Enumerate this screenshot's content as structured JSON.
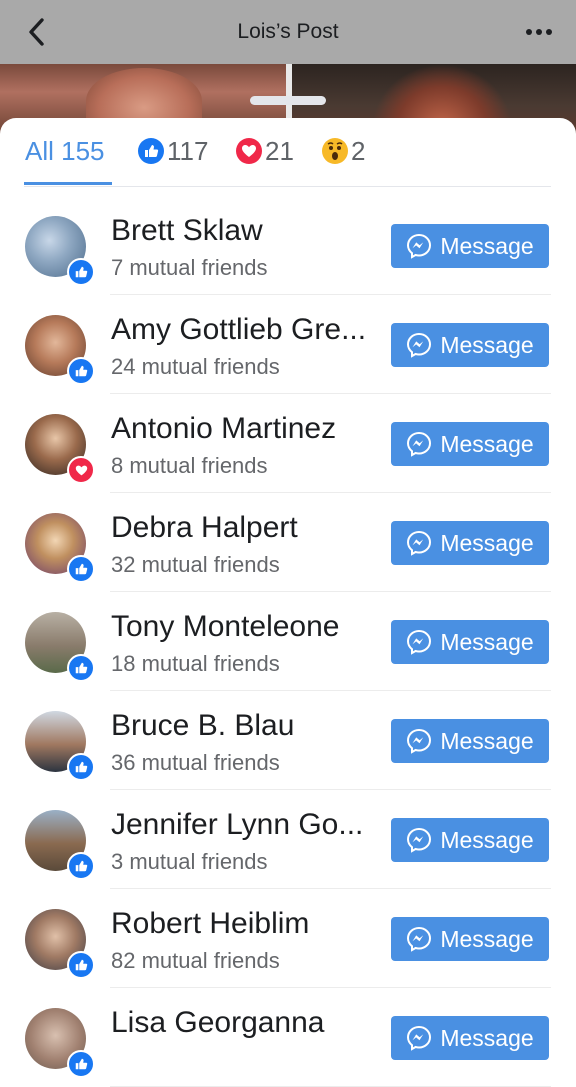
{
  "nav": {
    "title": "Lois’s Post",
    "back_icon": "chevron-left-icon",
    "more_icon": "more-dots-icon"
  },
  "colors": {
    "accent": "#4a90e2",
    "like": "#1877f2",
    "love": "#f02849",
    "wow": "#f7b928",
    "nav_bg": "#a9a9a9"
  },
  "tabs": {
    "all": "All 155",
    "like_count": "117",
    "love_count": "21",
    "wow_count": "2",
    "selected": "All"
  },
  "people": [
    {
      "name": "Brett Sklaw",
      "mutual": "7 mutual friends",
      "reaction": "like",
      "button": "Message"
    },
    {
      "name": "Amy Gottlieb Gre...",
      "mutual": "24 mutual friends",
      "reaction": "like",
      "button": "Message"
    },
    {
      "name": "Antonio Martinez",
      "mutual": "8 mutual friends",
      "reaction": "love",
      "button": "Message"
    },
    {
      "name": "Debra Halpert",
      "mutual": "32 mutual friends",
      "reaction": "like",
      "button": "Message"
    },
    {
      "name": "Tony Monteleone",
      "mutual": "18 mutual friends",
      "reaction": "like",
      "button": "Message"
    },
    {
      "name": "Bruce B. Blau",
      "mutual": "36 mutual friends",
      "reaction": "like",
      "button": "Message"
    },
    {
      "name": "Jennifer Lynn Go...",
      "mutual": "3 mutual friends",
      "reaction": "like",
      "button": "Message"
    },
    {
      "name": "Robert Heiblim",
      "mutual": "82 mutual friends",
      "reaction": "like",
      "button": "Message"
    },
    {
      "name": "Lisa Georganna",
      "mutual": "",
      "reaction": "like",
      "button": "Message"
    }
  ]
}
